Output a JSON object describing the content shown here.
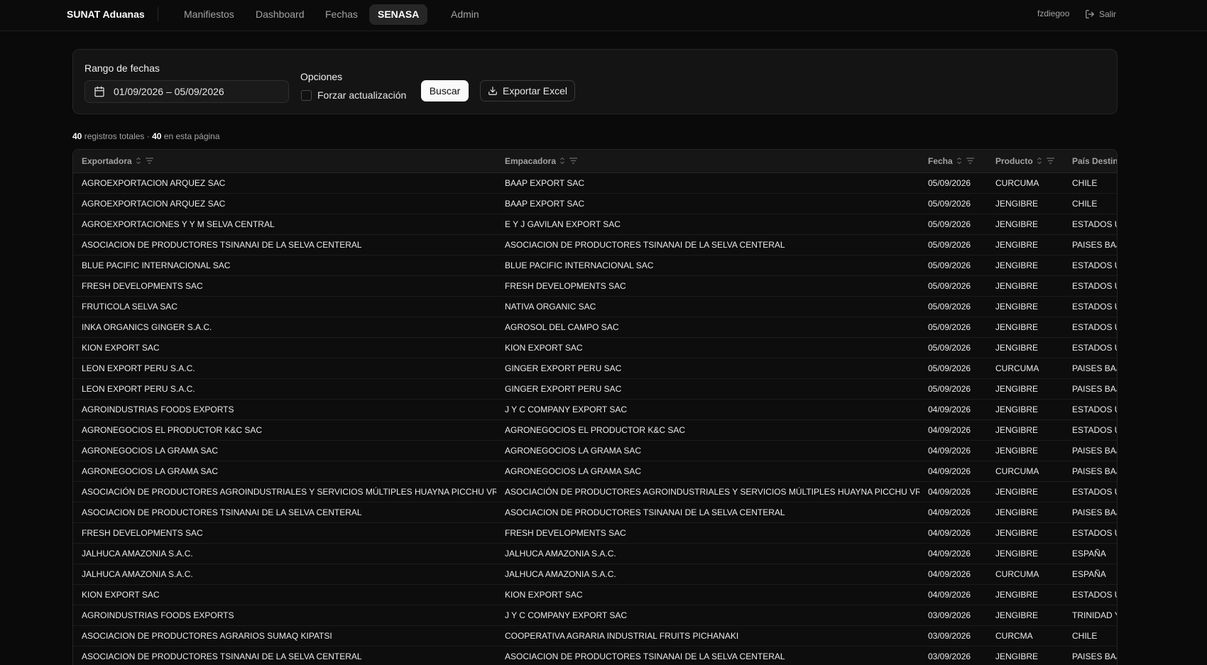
{
  "nav": {
    "brand": "SUNAT Aduanas",
    "items": [
      {
        "label": "Manifiestos",
        "active": false
      },
      {
        "label": "Dashboard",
        "active": false
      },
      {
        "label": "Fechas",
        "active": false
      },
      {
        "label": "SENASA",
        "active": true
      },
      {
        "label": "Admin",
        "active": false
      }
    ],
    "user": "fzdiegoo",
    "logout": "Salir"
  },
  "filters": {
    "range_label": "Rango de fechas",
    "range_value": "01/09/2026 – 05/09/2026",
    "options_label": "Opciones",
    "force_update_label": "Forzar actualización",
    "force_update_checked": false,
    "search_button": "Buscar",
    "export_button": "Exportar Excel"
  },
  "counts": {
    "total": "40",
    "total_text": "registros totales ·",
    "page": "40",
    "page_text": "en esta página"
  },
  "table": {
    "columns": [
      "Exportadora",
      "Empacadora",
      "Fecha",
      "Producto",
      "País Destino"
    ],
    "rows": [
      [
        "AGROEXPORTACION ARQUEZ SAC",
        "BAAP EXPORT SAC",
        "05/09/2026",
        "CURCUMA",
        "CHILE"
      ],
      [
        "AGROEXPORTACION ARQUEZ SAC",
        "BAAP EXPORT SAC",
        "05/09/2026",
        "JENGIBRE",
        "CHILE"
      ],
      [
        "AGROEXPORTACIONES Y Y M SELVA CENTRAL",
        "E Y J GAVILAN EXPORT SAC",
        "05/09/2026",
        "JENGIBRE",
        "ESTADOS UNIDOS"
      ],
      [
        "ASOCIACION DE PRODUCTORES TSINANAI DE LA SELVA CENTERAL",
        "ASOCIACION DE PRODUCTORES TSINANAI DE LA SELVA CENTERAL",
        "05/09/2026",
        "JENGIBRE",
        "PAISES BAJOS"
      ],
      [
        "BLUE PACIFIC INTERNACIONAL SAC",
        "BLUE PACIFIC INTERNACIONAL SAC",
        "05/09/2026",
        "JENGIBRE",
        "ESTADOS UNIDOS"
      ],
      [
        "FRESH DEVELOPMENTS SAC",
        "FRESH DEVELOPMENTS SAC",
        "05/09/2026",
        "JENGIBRE",
        "ESTADOS UNIDOS"
      ],
      [
        "FRUTICOLA SELVA SAC",
        "NATIVA ORGANIC SAC",
        "05/09/2026",
        "JENGIBRE",
        "ESTADOS UNIDOS"
      ],
      [
        "INKA ORGANICS GINGER S.A.C.",
        "AGROSOL DEL CAMPO SAC",
        "05/09/2026",
        "JENGIBRE",
        "ESTADOS UNIDOS"
      ],
      [
        "KION EXPORT SAC",
        "KION EXPORT SAC",
        "05/09/2026",
        "JENGIBRE",
        "ESTADOS UNIDOS"
      ],
      [
        "LEON EXPORT PERU S.A.C.",
        "GINGER EXPORT PERU SAC",
        "05/09/2026",
        "CURCUMA",
        "PAISES BAJOS"
      ],
      [
        "LEON EXPORT PERU S.A.C.",
        "GINGER EXPORT PERU SAC",
        "05/09/2026",
        "JENGIBRE",
        "PAISES BAJOS"
      ],
      [
        "AGROINDUSTRIAS FOODS EXPORTS",
        "J Y C COMPANY EXPORT SAC",
        "04/09/2026",
        "JENGIBRE",
        "ESTADOS UNIDOS"
      ],
      [
        "AGRONEGOCIOS EL PRODUCTOR K&C SAC",
        "AGRONEGOCIOS EL PRODUCTOR K&C SAC",
        "04/09/2026",
        "JENGIBRE",
        "ESTADOS UNIDOS"
      ],
      [
        "AGRONEGOCIOS LA GRAMA SAC",
        "AGRONEGOCIOS LA GRAMA SAC",
        "04/09/2026",
        "JENGIBRE",
        "PAISES BAJOS"
      ],
      [
        "AGRONEGOCIOS LA GRAMA SAC",
        "AGRONEGOCIOS LA GRAMA SAC",
        "04/09/2026",
        "CURCUMA",
        "PAISES BAJOS"
      ],
      [
        "ASOCIACIÓN DE PRODUCTORES AGROINDUSTRIALES Y SERVICIOS MÚLTIPLES HUAYNA PICCHU VRAE",
        "ASOCIACIÓN DE PRODUCTORES AGROINDUSTRIALES Y SERVICIOS MÚLTIPLES HUAYNA PICCHU VRAE",
        "04/09/2026",
        "JENGIBRE",
        "ESTADOS UNIDOS"
      ],
      [
        "ASOCIACION DE PRODUCTORES TSINANAI DE LA SELVA CENTERAL",
        "ASOCIACION DE PRODUCTORES TSINANAI DE LA SELVA CENTERAL",
        "04/09/2026",
        "JENGIBRE",
        "PAISES BAJOS"
      ],
      [
        "FRESH DEVELOPMENTS SAC",
        "FRESH DEVELOPMENTS SAC",
        "04/09/2026",
        "JENGIBRE",
        "ESTADOS UNIDOS"
      ],
      [
        "JALHUCA AMAZONIA S.A.C.",
        "JALHUCA AMAZONIA S.A.C.",
        "04/09/2026",
        "JENGIBRE",
        "ESPAÑA"
      ],
      [
        "JALHUCA AMAZONIA S.A.C.",
        "JALHUCA AMAZONIA S.A.C.",
        "04/09/2026",
        "CURCUMA",
        "ESPAÑA"
      ],
      [
        "KION EXPORT SAC",
        "KION EXPORT SAC",
        "04/09/2026",
        "JENGIBRE",
        "ESTADOS UNIDOS"
      ],
      [
        "AGROINDUSTRIAS FOODS EXPORTS",
        "J Y C COMPANY EXPORT SAC",
        "03/09/2026",
        "JENGIBRE",
        "TRINIDAD Y TOBAGO"
      ],
      [
        "ASOCIACION DE PRODUCTORES AGRARIOS SUMAQ KIPATSI",
        "COOPERATIVA AGRARIA INDUSTRIAL FRUITS PICHANAKI",
        "03/09/2026",
        "CURCMA",
        "CHILE"
      ],
      [
        "ASOCIACION DE PRODUCTORES TSINANAI DE LA SELVA CENTERAL",
        "ASOCIACION DE PRODUCTORES TSINANAI DE LA SELVA CENTERAL",
        "03/09/2026",
        "JENGIBRE",
        "PAISES BAJOS"
      ]
    ]
  },
  "icons": {
    "calendar": "calendar-icon",
    "download": "download-icon",
    "logout": "logout-icon",
    "sort": "sort-icon",
    "filter": "filter-icon"
  }
}
